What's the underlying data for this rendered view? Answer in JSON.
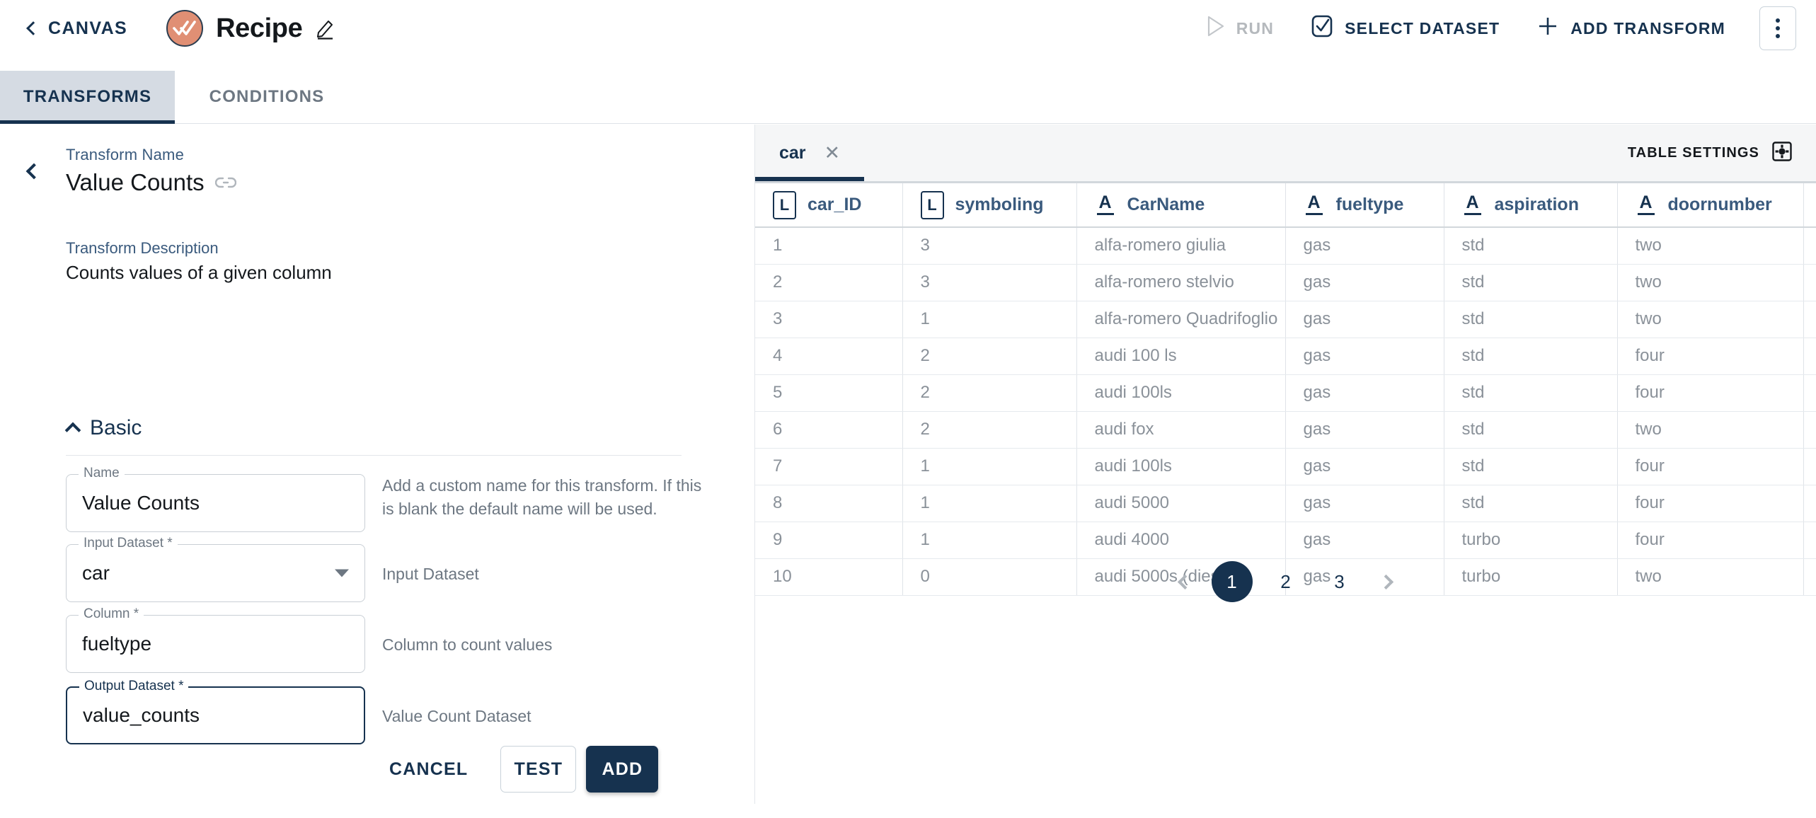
{
  "topbar": {
    "back_label": "CANVAS",
    "back_icon": "chevron-left-icon",
    "recipe_icon": "double-check-icon",
    "title": "Recipe",
    "edit_icon": "pencil-icon",
    "run_label": "RUN",
    "run_icon": "play-icon",
    "select_dataset_label": "SELECT DATASET",
    "select_dataset_icon": "checkbox-check-icon",
    "add_transform_label": "ADD TRANSFORM",
    "add_transform_icon": "plus-icon",
    "more_icon": "kebab-menu-icon"
  },
  "tabs": [
    {
      "label": "TRANSFORMS",
      "selected": true
    },
    {
      "label": "CONDITIONS",
      "selected": false
    }
  ],
  "left_panel": {
    "collapse_icon": "chevron-left-icon",
    "transform_name_label": "Transform Name",
    "transform_name_value": "Value Counts",
    "link_icon": "link-icon",
    "transform_description_label": "Transform Description",
    "transform_description_value": "Counts values of a given column",
    "section": {
      "title": "Basic",
      "toggle_icon": "chevron-up-icon"
    },
    "fields": [
      {
        "legend": "Name",
        "value": "Value Counts",
        "help": "Add a custom name for this transform. If this is blank the default name will be used.",
        "type": "text",
        "focused": false
      },
      {
        "legend": "Input Dataset *",
        "value": "car",
        "help": "Input Dataset",
        "type": "select",
        "focused": false
      },
      {
        "legend": "Column *",
        "value": "fueltype",
        "help": "Column to count values",
        "type": "text",
        "focused": false
      },
      {
        "legend": "Output Dataset *",
        "value": "value_counts",
        "help": "Value Count Dataset",
        "type": "text",
        "focused": true
      }
    ],
    "actions": {
      "cancel_label": "CANCEL",
      "test_label": "TEST",
      "add_label": "ADD"
    }
  },
  "right_panel": {
    "dataset_tabs": [
      {
        "label": "car",
        "selected": true,
        "close_icon": "close-icon"
      }
    ],
    "table_settings_label": "TABLE SETTINGS",
    "table_settings_icon": "gear-icon",
    "table": {
      "columns": [
        {
          "name": "car_ID",
          "type_badge": "L"
        },
        {
          "name": "symboling",
          "type_badge": "L"
        },
        {
          "name": "CarName",
          "type_badge": "A"
        },
        {
          "name": "fueltype",
          "type_badge": "A"
        },
        {
          "name": "aspiration",
          "type_badge": "A"
        },
        {
          "name": "doornumber",
          "type_badge": "A"
        },
        {
          "name": "",
          "type_badge": ""
        }
      ],
      "rows": [
        [
          "1",
          "3",
          "alfa-romero giulia",
          "gas",
          "std",
          "two",
          ""
        ],
        [
          "2",
          "3",
          "alfa-romero stelvio",
          "gas",
          "std",
          "two",
          ""
        ],
        [
          "3",
          "1",
          "alfa-romero Quadrifoglio",
          "gas",
          "std",
          "two",
          ""
        ],
        [
          "4",
          "2",
          "audi 100 ls",
          "gas",
          "std",
          "four",
          ""
        ],
        [
          "5",
          "2",
          "audi 100ls",
          "gas",
          "std",
          "four",
          ""
        ],
        [
          "6",
          "2",
          "audi fox",
          "gas",
          "std",
          "two",
          ""
        ],
        [
          "7",
          "1",
          "audi 100ls",
          "gas",
          "std",
          "four",
          ""
        ],
        [
          "8",
          "1",
          "audi 5000",
          "gas",
          "std",
          "four",
          ""
        ],
        [
          "9",
          "1",
          "audi 4000",
          "gas",
          "turbo",
          "four",
          ""
        ],
        [
          "10",
          "0",
          "audi 5000s (diesel)",
          "gas",
          "turbo",
          "two",
          ""
        ]
      ]
    },
    "pagination": {
      "prev_icon": "chevron-left-icon",
      "next_icon": "chevron-right-icon",
      "pages": [
        "1",
        "2",
        "3"
      ],
      "current": "1"
    }
  },
  "colors": {
    "brand_navy": "#16324f",
    "accent_salmon": "#e08f74",
    "tab_active_bg": "#d5dbe3",
    "muted_text": "#8a9199",
    "header_text": "#3a5a7d"
  }
}
